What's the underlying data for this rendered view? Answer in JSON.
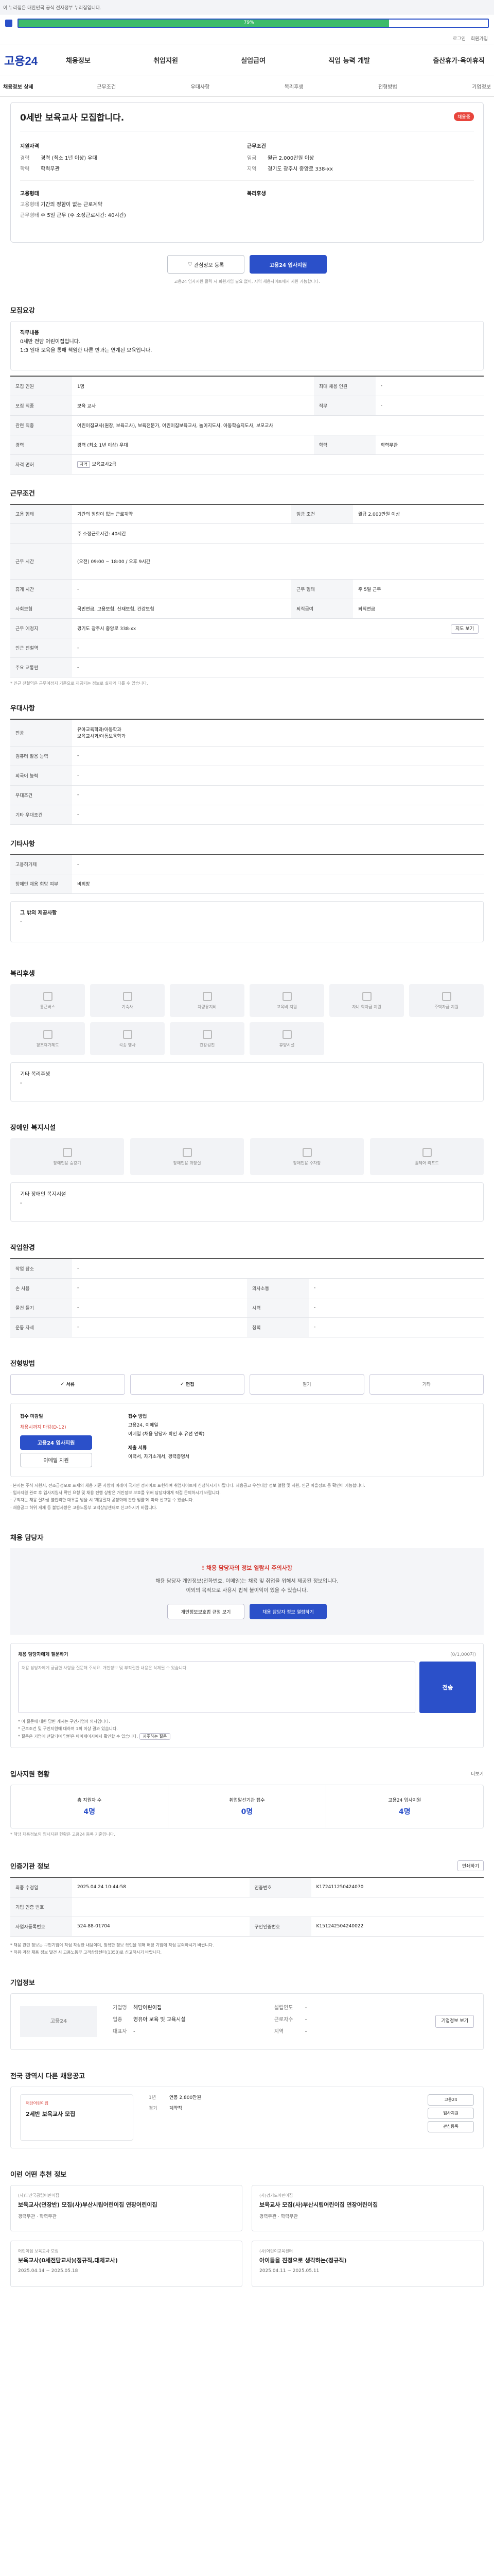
{
  "top_banner": {
    "text": "이 누리집은 대한민국 공식 전자정부 누리집입니다."
  },
  "loading": {
    "percent": "79%",
    "fraction": 0.79
  },
  "util_links": [
    "로그인",
    "회원가입"
  ],
  "header": {
    "logo": "고용24",
    "menu": [
      "채용정보",
      "취업지원",
      "실업급여",
      "직업 능력 개발",
      "출산휴가·육아휴직"
    ]
  },
  "subnav": [
    "채용정보 상세",
    "근무조건",
    "우대사항",
    "복리후생",
    "전형방법",
    "기업정보"
  ],
  "job": {
    "title": "0세반 보육교사 모집합니다.",
    "badge": "채용중",
    "req_heading": "지원자격",
    "cond_heading": "근무조건",
    "req": [
      {
        "k": "경력",
        "v": "경력 (최소 1년 이상) 우대"
      },
      {
        "k": "학력",
        "v": "학력무관"
      }
    ],
    "cond": [
      {
        "k": "임금",
        "v": "월급 2,000만원 이상"
      },
      {
        "k": "지역",
        "v": "경기도 광주시 중앙로 338-xx"
      }
    ],
    "type_heading": "고용형태",
    "types": [
      {
        "k": "고용형태",
        "v": "기간의 정함이 없는 근로계약"
      },
      {
        "k": "근무형태",
        "v": "주 5일 근무 (주 소정근로시간: 40시간)"
      }
    ],
    "welfare_heading": "복리후생",
    "btn_interest": "관심정보 등록",
    "btn_apply": "고용24 입사지원",
    "apply_note": "고용24 입사지원 클릭 시 회원가입 필요 없이, 지역 채용사이트에서 지원 가능합니다."
  },
  "recruit": {
    "heading": "모집요강",
    "job_heading": "직무내용",
    "job_lines": [
      "0세반 전담 어린이집입니다.",
      "1:3 일대 보육을 통해 책임한 다른 반과는 연계된 보육입니다."
    ],
    "rows": [
      {
        "k1": "모집 인원",
        "v1": "1명",
        "k2": "최대 채용 인원",
        "v2": "-"
      },
      {
        "k1": "모집 직종",
        "v1": "보육 교사",
        "k2": "직무",
        "v2": "-"
      },
      {
        "k1": "관련 직종",
        "v1": "어린이집교사(원장, 보육교사), 보육전문가, 어린이집보육교사, 놀이지도사, 아동학습지도사, 보모교사",
        "k2": "",
        "v2": ""
      },
      {
        "k1": "경력",
        "v1": "경력 (최소 1년 이상) 우대",
        "k2": "학력",
        "v2": "학력무관"
      },
      {
        "k1": "자격 면허",
        "v1": "보육교사2급",
        "k2": "",
        "v2": ""
      }
    ]
  },
  "conditions": {
    "heading": "근무조건",
    "rows": [
      {
        "k1": "고용 형태",
        "v1": "기간의 정함이 없는 근로계약",
        "k2": "임금 조건",
        "v2": "월급 2,000만원 이상"
      },
      {
        "k1": "",
        "v1": "주 소정근로시간: 40시간",
        "k2": "",
        "v2": ""
      },
      {
        "k1": "근무 시간",
        "v1": "(오전) 09:00 ~ 18:00 / 오후 9시간",
        "k2": "",
        "v2": ""
      },
      {
        "k1": "휴게 시간",
        "v1": "-",
        "k2": "근무 형태",
        "v2": "주 5일 근무"
      },
      {
        "k1": "사회보험",
        "v1": "국민연금, 고용보험, 산재보험, 건강보험",
        "k2": "퇴직급여",
        "v2": "퇴직연금"
      },
      {
        "k1": "근무 예정지",
        "v1": "경기도 광주시 중앙로 338-xx",
        "k2": "",
        "v2": ""
      },
      {
        "k1": "인근 전철역",
        "v1": "-",
        "k2": "",
        "v2": ""
      },
      {
        "k1": "주요 교통편",
        "v1": "-",
        "k2": "",
        "v2": ""
      }
    ],
    "map_button": "지도 보기",
    "note": "* 인근 전철역은 근무예정지 기준으로 제공되는 정보로 실제와 다를 수 있습니다."
  },
  "preference": {
    "heading": "우대사항",
    "rows": [
      {
        "k": "전공",
        "v": "유아교육학과/아동학과\n보육교사과/아동보육학과"
      },
      {
        "k": "컴퓨터 활용 능력",
        "v": "-"
      },
      {
        "k": "외국어 능력",
        "v": "-"
      },
      {
        "k": "우대조건",
        "v": "-"
      },
      {
        "k": "기타 우대조건",
        "v": "-"
      }
    ]
  },
  "other": {
    "heading": "기타사항",
    "rows": [
      {
        "k": "고용허가제",
        "v": "-"
      },
      {
        "k": "장애인 채용 희망 여부",
        "v": "비희망"
      }
    ],
    "extra_heading": "그 밖의 제공사항",
    "extra_value": "-"
  },
  "welfare": {
    "heading": "복리후생",
    "tiles": [
      "통근버스",
      "기숙사",
      "차량유지비",
      "교육비 지원",
      "자녀 학자금 지원",
      "주택자금 지원",
      "경조휴가제도",
      "각종 행사",
      "건강검진",
      "휴양시설"
    ],
    "other_label": "기타 복리후생",
    "other_value": "-"
  },
  "disability": {
    "heading": "장애인 복지시설",
    "tiles": [
      "장애인용 승강기",
      "장애인용 화장실",
      "장애인용 주차장",
      "휠체어 리프트"
    ],
    "other_label": "기타 장애인 복지시설",
    "other_value": "-"
  },
  "workplace": {
    "heading": "작업환경",
    "rows": [
      {
        "k1": "작업 장소",
        "v1": "-",
        "k2": "",
        "v2": ""
      },
      {
        "k1": "손 사용",
        "v1": "-",
        "k2": "의사소통",
        "v2": "-"
      },
      {
        "k1": "물건 들기",
        "v1": "-",
        "k2": "시력",
        "v2": "-"
      },
      {
        "k1": "운동 자세",
        "v1": "-",
        "k2": "청력",
        "v2": "-"
      }
    ]
  },
  "process": {
    "heading": "전형방법",
    "steps": [
      "서류",
      "면접",
      "필기",
      "기타"
    ],
    "active": [
      true,
      true,
      false,
      false
    ],
    "recv_title": "접수 마감일",
    "recv_deadline": "채용시까지 마감(D-12)",
    "recv_btn": "고용24 입사지원",
    "recv_btn2": "이메일 지원",
    "method_title": "접수 방법",
    "methods": [
      "고용24, 이메일",
      "이메일 (채용 담당자 확인 후 유선 연락)"
    ],
    "docs_title": "제출 서류",
    "docs": "이력서, 자기소개서, 경력증명서",
    "bullets": [
      "· 본지는 주식 지원서, 전조급성모로 표제의 채용 기준 사항의 미래이 국가인 정시이로 표현하여 취업사이트에 신청하시기 바랍니다. 채용공고 우선대상 정보 열람 및 지원, 인근 마을정보 등 확인이 가능합니다.",
      "· 입사지원 완료 후 입사지원서 확인 요청 및 채용 진행 상황은 개인정보 보호를 위해 담당자에게 직접 문의하시기 바랍니다.",
      "· 구직자는 채용 절차상 불합리한 대우를 받을 시 '채용절차 공정화에 관한 법률'에 따라 신고할 수 있습니다.",
      "· 채용공고 허위 게재 등 불법사항은 고용노동부 고객상담센터로 신고하시기 바랍니다."
    ]
  },
  "contact": {
    "heading": "채용 담당자",
    "warn": "채용 담당자의 정보 열람시 주의사항",
    "msg1": "채용 담당자 개인정보(전화번호, 이메일)는 채용 및 취업을 위해서 제공된 정보입니다.",
    "msg2": "이외의 목적으로 사용시 법적 불이익이 있을 수 있습니다.",
    "btn1": "개인정보보호법 규정 보기",
    "btn2": "채용 담당자 정보 열람하기",
    "q_title": "채용 담당자에게 질문하기",
    "q_count": "(0/1,000자)",
    "q_placeholder": "채용 담당자에게 궁금한 사항을 질문해 주세요. 개인정보 및 부적절한 내용은 삭제될 수 있습니다.",
    "q_btn": "전송",
    "q_notes": [
      "* 이 질문에 대한 답변 게시는 구인기업의 의사입니다.",
      "* 근로조건 및 구인지원에 대하여 1회 이상 결과 있습니다.",
      "* 질문은 기업에 전달되며 답변은 마이페이지에서 확인할 수 있습니다."
    ],
    "q_link": "자주하는 질문"
  },
  "status": {
    "heading": "입사지원 현황",
    "more": "더보기",
    "items": [
      {
        "label": "총 지원자 수",
        "value": "4명"
      },
      {
        "label": "취업알선기관 접수",
        "value": "0명"
      },
      {
        "label": "고용24 입사지원",
        "value": "4명"
      }
    ],
    "note": "* 해당 채용정보의 입사지원 현황은 고용24 등록 기준입니다."
  },
  "reg": {
    "heading": "인증기관 정보",
    "btn": "인쇄하기",
    "rows": [
      {
        "k1": "최종 수정일",
        "v1": "2025.04.24 10:44:58",
        "k2": "인증번호",
        "v2": "K172411250424070"
      },
      {
        "k1": "기업 인증 번호",
        "v1": "",
        "k2": "",
        "v2": ""
      },
      {
        "k1": "사업자등록번호",
        "v1": "524-88-01704",
        "k2": "구인인증번호",
        "v2": "K151242504240022"
      }
    ],
    "notes": [
      "* 채용 관련 정보는 구인기업이 직접 작성한 내용이며, 정확한 정보 확인을 위해 해당 기업에 직접 문의하시기 바랍니다.",
      "* 허위·과장 채용 정보 발견 시 고용노동부 고객상담센터(1350)로 신고하시기 바랍니다."
    ]
  },
  "company": {
    "heading": "기업정보",
    "logo": "고용24",
    "btn": "기업정보 보기",
    "rows": [
      {
        "k": "기업명",
        "v": "해담어린이집"
      },
      {
        "k": "업종",
        "v": "영유아 보육 및 교육시설"
      },
      {
        "k": "대표자",
        "v": "-"
      }
    ],
    "rows2": [
      {
        "k": "설립연도",
        "v": "-"
      },
      {
        "k": "근로자수",
        "v": "-"
      },
      {
        "k": "지역",
        "v": "-"
      }
    ]
  },
  "same": {
    "heading": "전국 광역시 다른 채용공고",
    "card_co": "해담어린이집",
    "card_title": "2세반 보육교사 모집",
    "info": [
      {
        "k": "1년",
        "v": "연봉 2,800만원"
      },
      {
        "k": "경기",
        "v": "계약직"
      }
    ],
    "btns": [
      "고용24",
      "입사지원",
      "관심등록"
    ]
  },
  "recommend": {
    "heading": "이런 어떤 추천 정보",
    "cards": [
      {
        "co": "(사)부산국공립어린이집",
        "title": "보육교사(연장반) 모집(사)부산시립어린이집 연장어린이집",
        "meta": "경력무관 · 학력무관"
      },
      {
        "co": "(사)경기도어린이집",
        "title": "보육교사 모집(사)부산시립어린이집 연장어린이집",
        "meta": "경력무관 · 학력무관"
      },
      {
        "co": "어린이집 보육교사 모집",
        "title": "보육교사(0세전담교사)(정규직,대체교사)",
        "meta": "2025.04.14 ~ 2025.05.18"
      },
      {
        "co": "(사)어린이교육센터",
        "title": "아이들을 진정으로 생각하는(정규직)",
        "meta": "2025.04.11 ~ 2025.05.11"
      }
    ]
  }
}
